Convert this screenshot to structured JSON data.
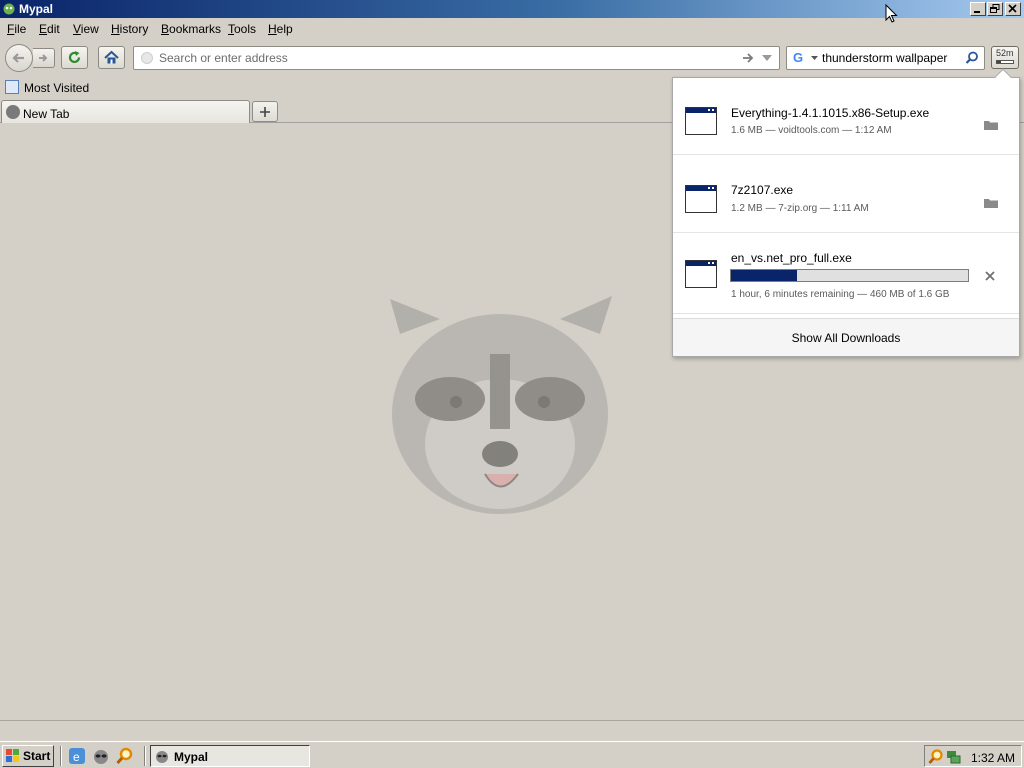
{
  "window": {
    "title": "Mypal"
  },
  "menu": {
    "items": [
      {
        "label": "File",
        "underline": "F",
        "rest": "ile"
      },
      {
        "label": "Edit",
        "underline": "E",
        "rest": "dit"
      },
      {
        "label": "View",
        "underline": "V",
        "rest": "iew"
      },
      {
        "label": "History",
        "underline": "H",
        "rest": "istory"
      },
      {
        "label": "Bookmarks",
        "underline": "B",
        "rest": "ookmarks"
      },
      {
        "label": "Tools",
        "underline": "T",
        "rest": "ools"
      },
      {
        "label": "Help",
        "underline": "H",
        "rest": "elp"
      }
    ]
  },
  "navbar": {
    "url_placeholder": "Search or enter address",
    "url_value": "",
    "search_engine_icon": "google-g-icon",
    "search_value": "thunderstorm wallpaper",
    "downloads_indicator_text": "52m"
  },
  "bookmarks": {
    "items": [
      {
        "label": "Most Visited"
      }
    ]
  },
  "tabs": [
    {
      "label": "New Tab",
      "selected": true
    }
  ],
  "downloads_panel": {
    "items": [
      {
        "name": "Everything-1.4.1.1015.x86-Setup.exe",
        "status": "1.6 MB — voidtools.com — 1:12 AM",
        "state": "complete",
        "action_icon": "folder-icon"
      },
      {
        "name": "7z2107.exe",
        "status": "1.2 MB — 7-zip.org — 1:11 AM",
        "state": "complete",
        "action_icon": "folder-icon"
      },
      {
        "name": "en_vs.net_pro_full.exe",
        "status": "1 hour, 6 minutes remaining — 460 MB of 1.6 GB",
        "state": "downloading",
        "progress": 0.28,
        "action_icon": "cancel-x-icon"
      }
    ],
    "show_all_label": "Show All Downloads"
  },
  "taskbar": {
    "start_label": "Start",
    "task_label": "Mypal",
    "clock": "1:32 AM"
  },
  "colors": {
    "titlebar_start": "#0a246a",
    "titlebar_end": "#a6caf0",
    "window_bg": "#d4d0c8",
    "progress_fill": "#0a246a"
  }
}
